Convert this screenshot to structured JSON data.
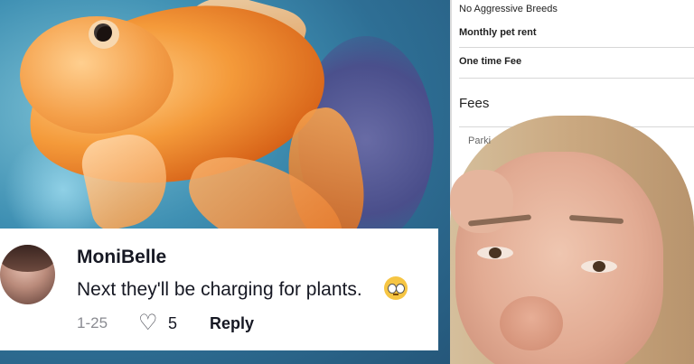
{
  "comment": {
    "username": "MoniBelle",
    "text": "Next they'll be charging for plants.",
    "date": "1-25",
    "likes": "5",
    "reply_label": "Reply"
  },
  "document": {
    "line1": "No Aggressive Breeds",
    "line2": "Monthly pet rent",
    "line3": "One time Fee",
    "section_title": "Fees",
    "row1": "Parki"
  },
  "icons": {
    "like": "heart-icon",
    "emoji": "eye-roll-emoji-icon"
  },
  "colors": {
    "text": "#161823",
    "meta": "#8a8b91"
  }
}
